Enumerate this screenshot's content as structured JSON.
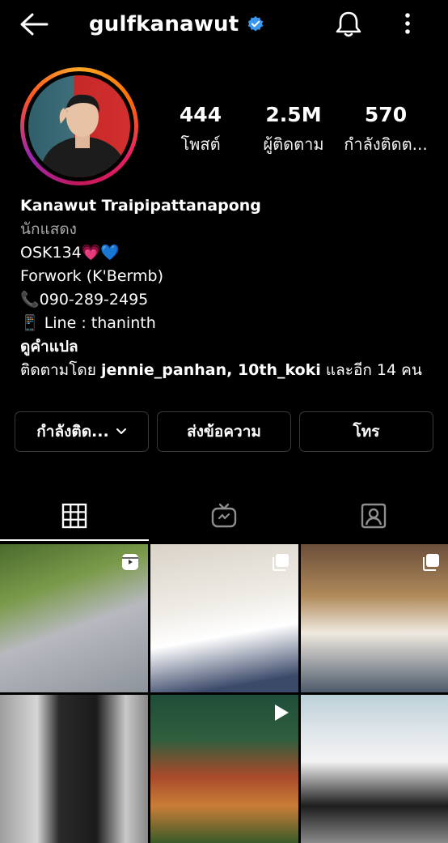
{
  "header": {
    "username": "gulfkanawut",
    "icons": [
      "back-arrow-icon",
      "verified-badge-icon",
      "bell-icon",
      "more-vertical-icon"
    ]
  },
  "stats": {
    "posts": {
      "value": "444",
      "label": "โพสต์"
    },
    "followers": {
      "value": "2.5M",
      "label": "ผู้ติดตาม"
    },
    "following": {
      "value": "570",
      "label": "กำลังติดต..."
    }
  },
  "bio": {
    "name": "Kanawut Traipipattanapong",
    "category": "นักแสดง",
    "line1": "OSK134💗💙",
    "line2": "Forwork (K'Bermb)",
    "line3": "📞090-289-2495",
    "line4": "📱 Line : thaninth",
    "translate": "ดูคำแปล",
    "followed_by_prefix": "ติดตามโดย ",
    "followed_by_users": "jennie_panhan, 10th_koki",
    "followed_by_suffix": " และอีก 14 คน"
  },
  "actions": {
    "following_label": "กำลังติด...",
    "message_label": "ส่งข้อความ",
    "call_label": "โทร"
  },
  "tabs": [
    {
      "icon": "grid-icon",
      "active": true
    },
    {
      "icon": "igtv-icon",
      "active": false
    },
    {
      "icon": "tagged-icon",
      "active": false
    }
  ],
  "posts": [
    {
      "type": "reel",
      "badge": "reel-icon"
    },
    {
      "type": "carousel",
      "badge": "carousel-icon"
    },
    {
      "type": "carousel",
      "badge": "carousel-icon"
    },
    {
      "type": "photo",
      "badge": ""
    },
    {
      "type": "video",
      "badge": "play-icon"
    },
    {
      "type": "photo",
      "badge": ""
    }
  ],
  "colors": {
    "background": "#000000",
    "text": "#ffffff",
    "secondary_text": "#a8a8a8",
    "verified": "#3897f0",
    "button_border": "#3a3a3a"
  }
}
